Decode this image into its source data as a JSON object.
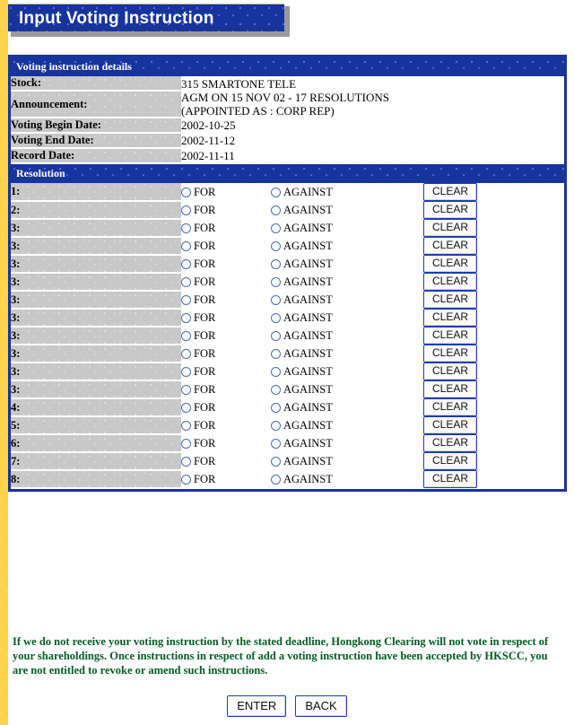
{
  "page": {
    "title": "Input Voting Instruction",
    "accent_blue": "#17339c",
    "gold_strip": "#fcd34a",
    "notice_green": "#035c22",
    "field_gray": "#c8c8c8"
  },
  "details": {
    "section_title": "Voting instruction details",
    "rows": [
      {
        "label": "Stock:",
        "value": "315 SMARTONE TELE",
        "value2": ""
      },
      {
        "label": "Announcement:",
        "value": "AGM ON 15 NOV 02 - 17 RESOLUTIONS",
        "value2": "(APPOINTED AS : CORP REP)"
      },
      {
        "label": "Voting Begin Date:",
        "value": "2002-10-25",
        "value2": ""
      },
      {
        "label": "Voting End Date:",
        "value": "2002-11-12",
        "value2": ""
      },
      {
        "label": "Record Date:",
        "value": "2002-11-11",
        "value2": ""
      }
    ]
  },
  "resolutions": {
    "section_title": "Resolution",
    "for_label": "FOR",
    "against_label": "AGAINST",
    "clear_label": "CLEAR",
    "rows": [
      {
        "num": "1:"
      },
      {
        "num": "2:"
      },
      {
        "num": "3:"
      },
      {
        "num": "3:"
      },
      {
        "num": "3:"
      },
      {
        "num": "3:"
      },
      {
        "num": "3:"
      },
      {
        "num": "3:"
      },
      {
        "num": "3:"
      },
      {
        "num": "3:"
      },
      {
        "num": "3:"
      },
      {
        "num": "3:"
      },
      {
        "num": "4:"
      },
      {
        "num": "5:"
      },
      {
        "num": "6:"
      },
      {
        "num": "7:"
      },
      {
        "num": "8:"
      }
    ]
  },
  "notice": {
    "text": "If we do not receive your voting instruction by the stated deadline, Hongkong Clearing will not vote in respect of your shareholdings. Once instructions in respect of add a voting instruction have been accepted by HKSCC, you are not entitled to revoke or amend such instructions."
  },
  "footer": {
    "enter_label": "ENTER",
    "back_label": "BACK"
  }
}
